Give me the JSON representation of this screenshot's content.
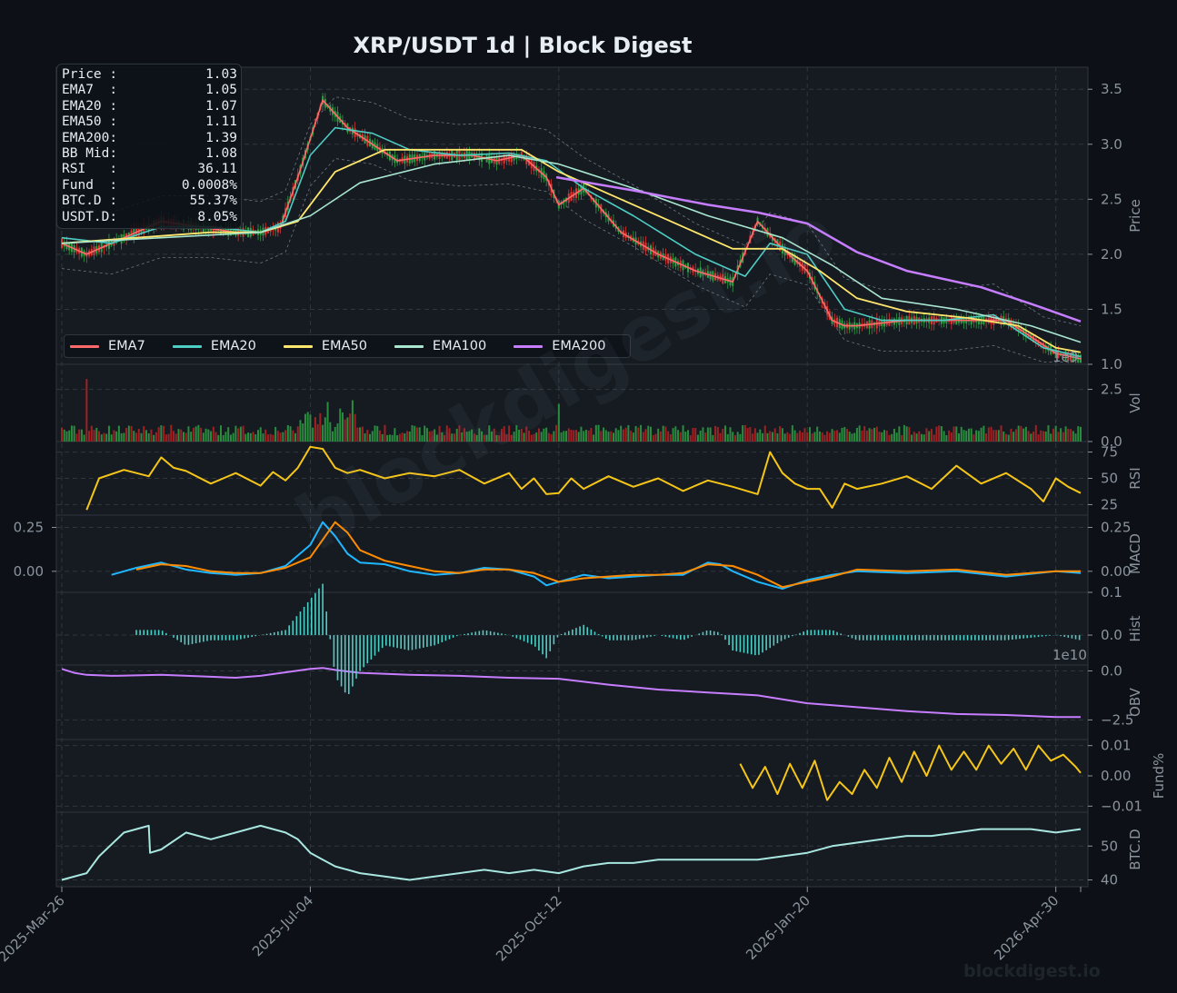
{
  "title": "XRP/USDT  1d  |  Block Digest",
  "footer": "blockdigest.io",
  "watermark": "blockdigest.io",
  "info": [
    {
      "label": "Price :",
      "value": "1.03"
    },
    {
      "label": "EMA7  :",
      "value": "1.05"
    },
    {
      "label": "EMA20 :",
      "value": "1.07"
    },
    {
      "label": "EMA50 :",
      "value": "1.11"
    },
    {
      "label": "EMA200:",
      "value": "1.39"
    },
    {
      "label": "BB Mid:",
      "value": "1.08"
    },
    {
      "label": "RSI   :",
      "value": "36.11"
    },
    {
      "label": "Fund  :",
      "value": "0.0008%"
    },
    {
      "label": "BTC.D :",
      "value": "55.37%"
    },
    {
      "label": "USDT.D:",
      "value": "8.05%"
    }
  ],
  "legend": [
    {
      "name": "EMA7",
      "color": "#ff6b6b"
    },
    {
      "name": "EMA20",
      "color": "#4ecdc4"
    },
    {
      "name": "EMA50",
      "color": "#ffe66d"
    },
    {
      "name": "EMA100",
      "color": "#a8e6cf"
    },
    {
      "name": "EMA200",
      "color": "#c77dff"
    }
  ],
  "sci_labels": {
    "vol": "1e9",
    "obv": "1e10"
  },
  "chart_data": {
    "type": "line",
    "x_ticks": [
      "2025-Mar-26",
      "2025-Jul-04",
      "2025-Oct-12",
      "2026-Jan-20",
      "2026-Apr-30"
    ],
    "x_range_days": [
      0,
      410
    ],
    "x_tick_days": [
      0,
      100,
      200,
      300,
      400
    ],
    "panels": [
      {
        "key": "price",
        "ylabel": "Price",
        "ylim": [
          1.0,
          3.7
        ],
        "ticks": [
          "1.0",
          "1.5",
          "2.0",
          "2.5",
          "3.0",
          "3.5"
        ],
        "tick_values": [
          1.0,
          1.5,
          2.0,
          2.5,
          3.0,
          3.5
        ]
      },
      {
        "key": "vol",
        "ylabel": "Vol",
        "ylim": [
          0,
          3.7
        ],
        "ticks": [
          "0.0",
          "2.5"
        ],
        "tick_values": [
          0,
          2.5
        ]
      },
      {
        "key": "rsi",
        "ylabel": "RSI",
        "ylim": [
          15,
          85
        ],
        "ticks": [
          "25",
          "50",
          "75"
        ],
        "tick_values": [
          25,
          50,
          75
        ]
      },
      {
        "key": "macd",
        "ylabel": "MACD",
        "ylim": [
          -0.12,
          0.32
        ],
        "ticks": [
          "0.00",
          "0.25"
        ],
        "tick_values": [
          0,
          0.25
        ],
        "left_ticks": [
          "0.00",
          "0.25"
        ]
      },
      {
        "key": "hist",
        "ylabel": "Hist",
        "ylim": [
          -0.07,
          0.1
        ],
        "ticks": [
          "0.0",
          "0.1"
        ],
        "tick_values": [
          0,
          0.1
        ]
      },
      {
        "key": "obv",
        "ylabel": "OBV",
        "ylim": [
          -3.5,
          0.3
        ],
        "ticks": [
          "−2.5",
          "0.0"
        ],
        "tick_values": [
          -2.5,
          0
        ]
      },
      {
        "key": "fund",
        "ylabel": "Fund%",
        "ylim": [
          -0.012,
          0.012
        ],
        "ticks": [
          "−0.01",
          "0.00",
          "0.01"
        ],
        "tick_values": [
          -0.01,
          0,
          0.01
        ]
      },
      {
        "key": "btcd",
        "ylabel": "BTC.D",
        "ylim": [
          38,
          60
        ],
        "ticks": [
          "40",
          "50"
        ],
        "tick_values": [
          40,
          50
        ]
      }
    ],
    "series": [
      {
        "name": "EMA7",
        "panel": "price",
        "x": [
          0,
          10,
          25,
          40,
          55,
          70,
          80,
          88,
          95,
          105,
          115,
          125,
          135,
          150,
          165,
          175,
          185,
          195,
          200,
          210,
          225,
          240,
          255,
          270,
          280,
          290,
          300,
          310,
          315,
          320,
          340,
          360,
          380,
          400,
          410
        ],
        "y": [
          2.1,
          2.0,
          2.15,
          2.3,
          2.25,
          2.2,
          2.2,
          2.25,
          2.7,
          3.4,
          3.15,
          3.0,
          2.85,
          2.9,
          2.9,
          2.85,
          2.9,
          2.7,
          2.45,
          2.6,
          2.2,
          2.0,
          1.85,
          1.75,
          2.3,
          2.05,
          1.85,
          1.4,
          1.35,
          1.35,
          1.4,
          1.4,
          1.4,
          1.1,
          1.05
        ]
      },
      {
        "name": "EMA20",
        "panel": "price",
        "x": [
          0,
          20,
          40,
          60,
          80,
          90,
          100,
          110,
          125,
          140,
          160,
          180,
          195,
          210,
          230,
          255,
          275,
          285,
          300,
          315,
          330,
          355,
          375,
          395,
          410
        ],
        "y": [
          2.15,
          2.1,
          2.25,
          2.25,
          2.2,
          2.3,
          2.9,
          3.15,
          3.1,
          2.95,
          2.9,
          2.92,
          2.85,
          2.6,
          2.35,
          2.0,
          1.8,
          2.1,
          2.0,
          1.5,
          1.4,
          1.4,
          1.45,
          1.15,
          1.07
        ]
      },
      {
        "name": "EMA50",
        "panel": "price",
        "x": [
          0,
          30,
          60,
          80,
          95,
          110,
          130,
          160,
          185,
          200,
          220,
          245,
          270,
          290,
          305,
          320,
          340,
          365,
          385,
          400,
          410
        ],
        "y": [
          2.1,
          2.15,
          2.2,
          2.2,
          2.3,
          2.75,
          2.95,
          2.95,
          2.95,
          2.75,
          2.55,
          2.3,
          2.05,
          2.05,
          1.85,
          1.6,
          1.48,
          1.42,
          1.35,
          1.15,
          1.11
        ]
      },
      {
        "name": "EMA100",
        "panel": "price",
        "x": [
          0,
          40,
          80,
          100,
          120,
          150,
          180,
          200,
          230,
          260,
          290,
          310,
          330,
          360,
          390,
          410
        ],
        "y": [
          2.1,
          2.15,
          2.2,
          2.35,
          2.65,
          2.82,
          2.9,
          2.82,
          2.6,
          2.35,
          2.15,
          1.9,
          1.6,
          1.5,
          1.35,
          1.2
        ]
      },
      {
        "name": "EMA200",
        "panel": "price",
        "x": [
          199,
          230,
          260,
          280,
          300,
          320,
          340,
          370,
          390,
          410
        ],
        "y": [
          2.7,
          2.58,
          2.45,
          2.38,
          2.28,
          2.02,
          1.85,
          1.7,
          1.55,
          1.39
        ]
      },
      {
        "name": "RSI",
        "panel": "rsi",
        "x": [
          10,
          15,
          25,
          35,
          40,
          45,
          50,
          60,
          70,
          80,
          85,
          90,
          95,
          100,
          105,
          110,
          115,
          120,
          130,
          140,
          150,
          160,
          170,
          180,
          185,
          190,
          195,
          200,
          205,
          210,
          220,
          230,
          240,
          250,
          260,
          270,
          280,
          285,
          290,
          295,
          300,
          305,
          310,
          315,
          320,
          330,
          340,
          350,
          360,
          370,
          380,
          390,
          395,
          400,
          405,
          410
        ],
        "y": [
          20,
          50,
          58,
          52,
          70,
          60,
          57,
          45,
          55,
          43,
          56,
          48,
          60,
          80,
          78,
          60,
          55,
          58,
          50,
          55,
          52,
          58,
          45,
          55,
          40,
          50,
          35,
          36,
          50,
          40,
          52,
          42,
          50,
          38,
          48,
          42,
          35,
          75,
          55,
          45,
          40,
          40,
          22,
          45,
          40,
          45,
          52,
          40,
          62,
          45,
          55,
          40,
          28,
          50,
          42,
          36
        ]
      },
      {
        "name": "MACD",
        "panel": "macd",
        "x": [
          20,
          30,
          40,
          50,
          60,
          70,
          80,
          90,
          100,
          105,
          110,
          115,
          120,
          130,
          140,
          150,
          160,
          170,
          180,
          190,
          195,
          200,
          210,
          220,
          230,
          240,
          250,
          260,
          265,
          270,
          280,
          290,
          300,
          310,
          320,
          340,
          360,
          380,
          400,
          410
        ],
        "y": [
          -0.02,
          0.02,
          0.05,
          0.01,
          -0.01,
          -0.02,
          -0.01,
          0.03,
          0.15,
          0.28,
          0.2,
          0.1,
          0.05,
          0.04,
          0.0,
          -0.02,
          -0.01,
          0.02,
          0.01,
          -0.03,
          -0.08,
          -0.06,
          -0.02,
          -0.04,
          -0.03,
          -0.02,
          -0.02,
          0.05,
          0.04,
          0.0,
          -0.06,
          -0.1,
          -0.05,
          -0.02,
          0.0,
          -0.01,
          0.0,
          -0.03,
          0.0,
          -0.01
        ]
      },
      {
        "name": "Signal",
        "panel": "macd",
        "x": [
          30,
          40,
          50,
          60,
          70,
          80,
          90,
          100,
          110,
          115,
          120,
          130,
          140,
          150,
          160,
          170,
          180,
          190,
          200,
          210,
          220,
          230,
          240,
          250,
          260,
          270,
          280,
          290,
          300,
          310,
          320,
          340,
          360,
          380,
          400,
          410
        ],
        "y": [
          0.01,
          0.04,
          0.03,
          0.0,
          -0.01,
          -0.01,
          0.02,
          0.08,
          0.28,
          0.22,
          0.12,
          0.06,
          0.03,
          0.0,
          -0.01,
          0.01,
          0.01,
          -0.01,
          -0.06,
          -0.04,
          -0.03,
          -0.02,
          -0.02,
          -0.01,
          0.04,
          0.03,
          -0.02,
          -0.09,
          -0.06,
          -0.03,
          0.01,
          0.0,
          0.01,
          -0.02,
          0.0,
          0.0
        ]
      },
      {
        "name": "OBV",
        "panel": "obv",
        "x": [
          0,
          5,
          10,
          20,
          40,
          60,
          70,
          80,
          100,
          105,
          110,
          120,
          140,
          160,
          180,
          200,
          220,
          240,
          260,
          280,
          300,
          320,
          340,
          360,
          380,
          400,
          410
        ],
        "y": [
          0.1,
          -0.1,
          -0.2,
          -0.25,
          -0.2,
          -0.3,
          -0.35,
          -0.25,
          0.1,
          0.15,
          0.05,
          -0.1,
          -0.2,
          -0.25,
          -0.35,
          -0.4,
          -0.7,
          -0.95,
          -1.1,
          -1.25,
          -1.65,
          -1.85,
          -2.05,
          -2.2,
          -2.25,
          -2.35,
          -2.35
        ]
      },
      {
        "name": "Fund",
        "panel": "fund",
        "x": [
          273,
          278,
          283,
          288,
          293,
          298,
          303,
          308,
          313,
          318,
          323,
          328,
          333,
          338,
          343,
          348,
          353,
          358,
          363,
          368,
          373,
          378,
          383,
          388,
          393,
          398,
          403,
          408,
          410
        ],
        "y": [
          0.004,
          -0.004,
          0.003,
          -0.006,
          0.004,
          -0.004,
          0.005,
          -0.008,
          -0.002,
          -0.006,
          0.002,
          -0.004,
          0.006,
          -0.002,
          0.008,
          0.0,
          0.01,
          0.002,
          0.008,
          0.002,
          0.01,
          0.004,
          0.009,
          0.002,
          0.01,
          0.005,
          0.007,
          0.003,
          0.001
        ]
      },
      {
        "name": "BTC.D",
        "panel": "btcd",
        "x": [
          0,
          10,
          15,
          25,
          35,
          35.5,
          40,
          50,
          60,
          70,
          80,
          85,
          90,
          95,
          100,
          105,
          110,
          120,
          130,
          140,
          150,
          160,
          170,
          180,
          190,
          200,
          210,
          220,
          230,
          240,
          250,
          260,
          270,
          280,
          290,
          300,
          310,
          320,
          330,
          340,
          350,
          360,
          370,
          380,
          390,
          400,
          410
        ],
        "y": [
          40,
          42,
          47,
          54,
          56,
          48,
          49,
          54,
          52,
          54,
          56,
          55,
          54,
          52,
          48,
          46,
          44,
          42,
          41,
          40,
          41,
          42,
          43,
          42,
          43,
          42,
          44,
          45,
          45,
          46,
          46,
          46,
          46,
          46,
          47,
          48,
          50,
          51,
          52,
          53,
          53,
          54,
          55,
          55,
          55,
          54,
          55
        ]
      }
    ]
  }
}
